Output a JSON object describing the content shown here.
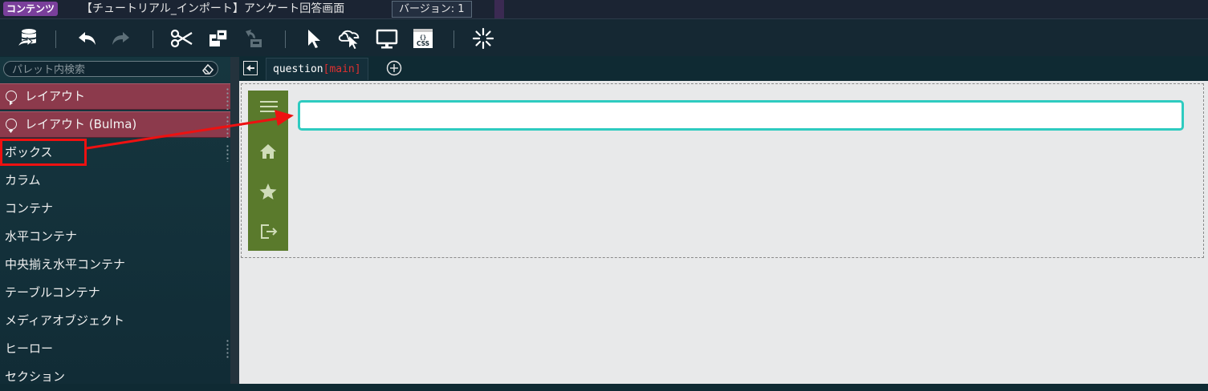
{
  "titlebar": {
    "badge": "コンテンツ",
    "title": "【チュートリアル_インポート】アンケート回答画面",
    "version": "バージョン: 1"
  },
  "toolbar": {
    "icons": [
      "database-icon",
      "undo-icon",
      "redo-icon",
      "cut-icon",
      "component-icon",
      "disabled-tool-icon",
      "pointer-icon",
      "cloud-pointer-icon",
      "monitor-icon",
      "css-icon",
      "loading-spinner-icon"
    ]
  },
  "palette": {
    "search_placeholder": "パレット内検索",
    "categories": [
      {
        "label": "レイアウト",
        "state": "collapsed"
      },
      {
        "label": "レイアウト (Bulma)",
        "state": "expanded"
      }
    ],
    "items": [
      "ボックス",
      "カラム",
      "コンテナ",
      "水平コンテナ",
      "中央揃え水平コンテナ",
      "テーブルコンテナ",
      "メディアオブジェクト",
      "ヒーロー",
      "セクション"
    ]
  },
  "editor": {
    "tab_name": "question",
    "tab_suffix": "[main]"
  },
  "colors": {
    "category_bg": "#8c3a4c",
    "sidebar_green": "#5a7a2c",
    "textbox_border": "#2ecbc0",
    "annotation_red": "#ee1111",
    "badge_purple": "#7a3f9b"
  }
}
